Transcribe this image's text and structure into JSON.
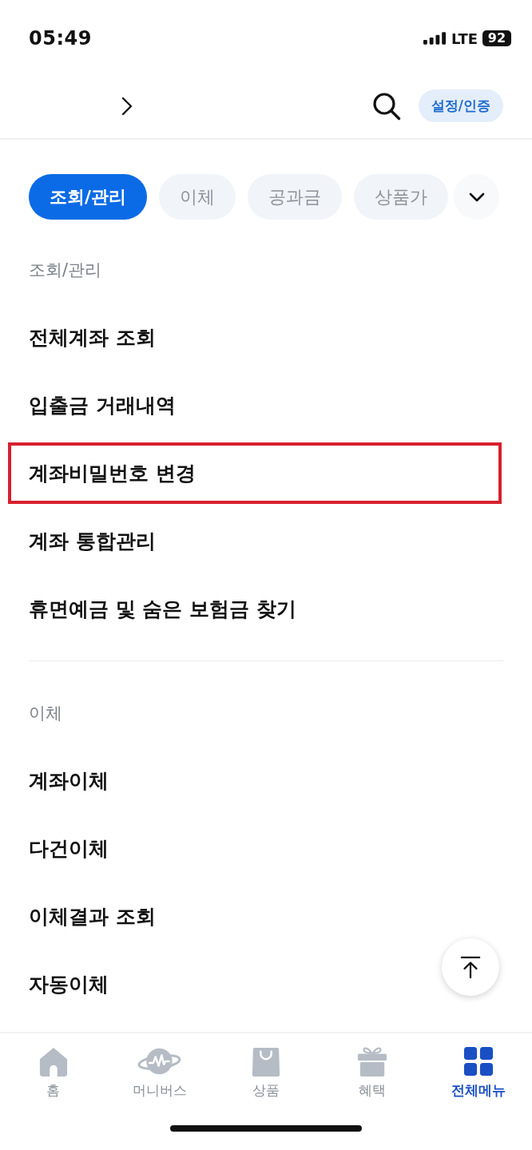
{
  "status_bar": {
    "time": "05:49",
    "network": "LTE",
    "battery": "92"
  },
  "header": {
    "settings_button": "설정/인증"
  },
  "tabs": [
    {
      "label": "조회/관리",
      "selected": true
    },
    {
      "label": "이체",
      "selected": false
    },
    {
      "label": "공과금",
      "selected": false
    },
    {
      "label": "상품가",
      "selected": false
    }
  ],
  "sections": [
    {
      "title": "조회/관리",
      "items": [
        {
          "label": "전체계좌 조회",
          "highlighted": false
        },
        {
          "label": "입출금 거래내역",
          "highlighted": false
        },
        {
          "label": "계좌비밀번호 변경",
          "highlighted": true
        },
        {
          "label": "계좌 통합관리",
          "highlighted": false
        },
        {
          "label": "휴면예금 및 숨은 보험금 찾기",
          "highlighted": false
        }
      ]
    },
    {
      "title": "이체",
      "items": [
        {
          "label": "계좌이체",
          "highlighted": false
        },
        {
          "label": "다건이체",
          "highlighted": false
        },
        {
          "label": "이체결과 조회",
          "highlighted": false
        },
        {
          "label": "자동이체",
          "highlighted": false
        }
      ]
    }
  ],
  "bottom_nav": [
    {
      "label": "홈",
      "selected": false
    },
    {
      "label": "머니버스",
      "selected": false
    },
    {
      "label": "상품",
      "selected": false
    },
    {
      "label": "혜택",
      "selected": false
    },
    {
      "label": "전체메뉴",
      "selected": true
    }
  ]
}
